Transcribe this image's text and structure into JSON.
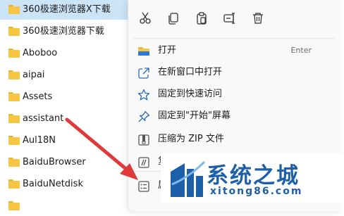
{
  "files": [
    {
      "name": "360极速浏览器X下载",
      "selected": true
    },
    {
      "name": "360极速浏览器下载",
      "selected": false
    },
    {
      "name": "Aboboo",
      "selected": false
    },
    {
      "name": "aipai",
      "selected": false
    },
    {
      "name": "Assets",
      "selected": false
    },
    {
      "name": "assistant",
      "selected": false
    },
    {
      "name": "Aul18N",
      "selected": false
    },
    {
      "name": "BaiduBrowser",
      "selected": false
    },
    {
      "name": "BaiduNetdisk",
      "selected": false
    }
  ],
  "context_menu": {
    "quick_actions": [
      "cut-icon",
      "copy-icon",
      "paste-icon",
      "rename-icon",
      "delete-icon"
    ],
    "items": [
      {
        "label": "打开",
        "shortcut": "Enter",
        "icon": "folder-icon"
      },
      {
        "label": "在新窗口中打开",
        "icon": "open-new-window-icon"
      },
      {
        "label": "固定到快速访问",
        "icon": "star-icon"
      },
      {
        "label": "固定到\"开始\"屏幕",
        "icon": "pin-icon"
      },
      {
        "label": "压缩为 ZIP 文件",
        "icon": "zip-icon"
      },
      {
        "label": "复",
        "icon": "copy-path-icon"
      },
      {
        "label": "属",
        "icon": "properties-icon"
      }
    ]
  },
  "watermark": {
    "title": "系统之城",
    "url": "xitong86.com"
  },
  "colors": {
    "selection": "#cce4f7",
    "folder": "#f5c543",
    "arrow": "#e0393a",
    "watermark_blue": "#1d5fa8"
  }
}
